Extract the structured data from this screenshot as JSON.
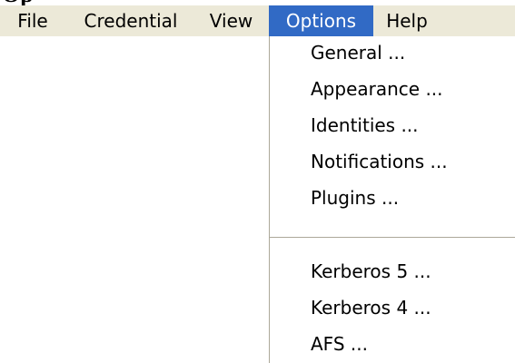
{
  "clipped_heading": "Op",
  "menubar": {
    "file": "File",
    "credential": "Credential",
    "view": "View",
    "options": "Options",
    "help": "Help"
  },
  "options_menu": {
    "items": [
      "General ...",
      "Appearance ...",
      "Identities ...",
      "Notifications ...",
      "Plugins ...",
      "Kerberos 5 ...",
      "Kerberos 4 ...",
      "AFS ..."
    ]
  },
  "colors": {
    "menubar_background": "#ece9d8",
    "highlight": "#316ac5",
    "highlight_text": "#ffffff",
    "separator": "#aca899"
  }
}
